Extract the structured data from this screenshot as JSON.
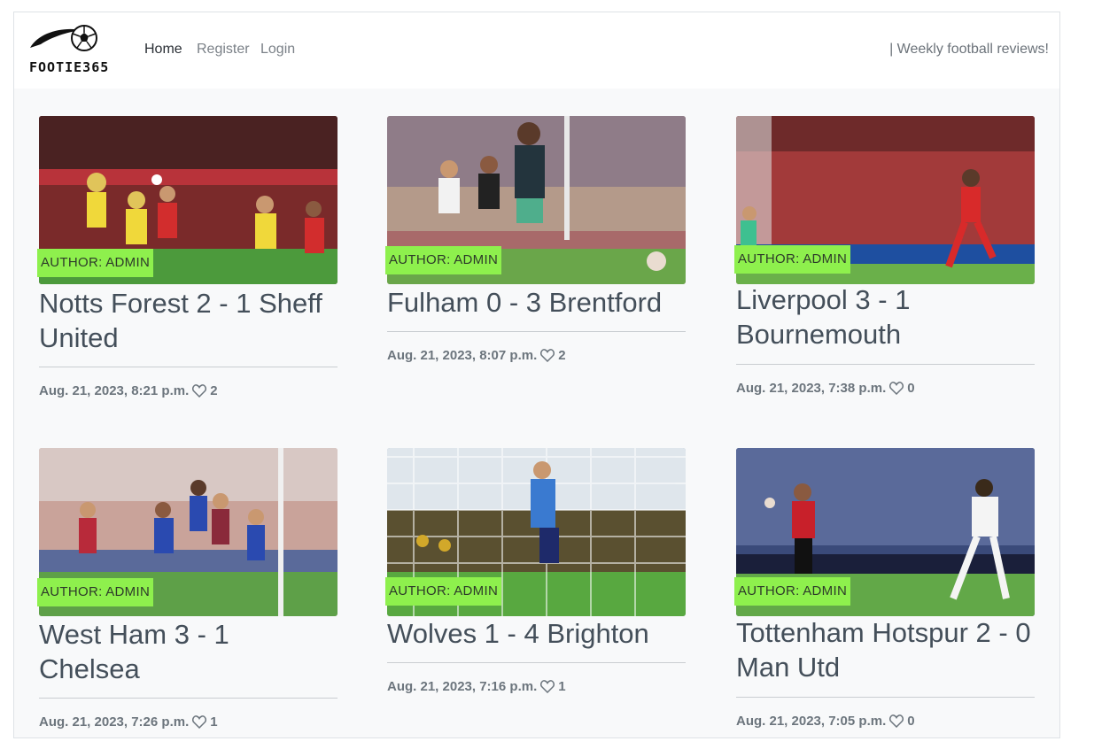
{
  "brand": {
    "name": "FOOTIE365",
    "logo_icon": "football-logo-icon"
  },
  "nav": {
    "items": [
      {
        "label": "Home",
        "active": true
      },
      {
        "label": "Register",
        "active": false
      },
      {
        "label": "Login",
        "active": false
      }
    ],
    "tagline": "| Weekly football reviews!"
  },
  "posts": [
    {
      "title": "Notts Forest 2 - 1 Sheff United",
      "author": "AUTHOR: ADMIN",
      "date": "Aug. 21, 2023, 8:21 p.m.",
      "likes": "2",
      "like_icon": "heart-icon"
    },
    {
      "title": "Fulham 0 - 3 Brentford",
      "author": "AUTHOR: ADMIN",
      "date": "Aug. 21, 2023, 8:07 p.m.",
      "likes": "2",
      "like_icon": "heart-icon"
    },
    {
      "title": "Liverpool 3 - 1 Bournemouth",
      "author": "AUTHOR: ADMIN",
      "date": "Aug. 21, 2023, 7:38 p.m.",
      "likes": "0",
      "like_icon": "heart-icon"
    },
    {
      "title": "West Ham 3 - 1 Chelsea",
      "author": "AUTHOR: ADMIN",
      "date": "Aug. 21, 2023, 7:26 p.m.",
      "likes": "1",
      "like_icon": "heart-icon"
    },
    {
      "title": "Wolves 1 - 4 Brighton",
      "author": "AUTHOR: ADMIN",
      "date": "Aug. 21, 2023, 7:16 p.m.",
      "likes": "1",
      "like_icon": "heart-icon"
    },
    {
      "title": "Tottenham Hotspur 2 - 0 Man Utd",
      "author": "AUTHOR: ADMIN",
      "date": "Aug. 21, 2023, 7:05 p.m.",
      "likes": "0",
      "like_icon": "heart-icon"
    }
  ],
  "colors": {
    "author_badge": "#8ef04d",
    "background": "#f8f9fa",
    "navbar": "#ffffff"
  }
}
